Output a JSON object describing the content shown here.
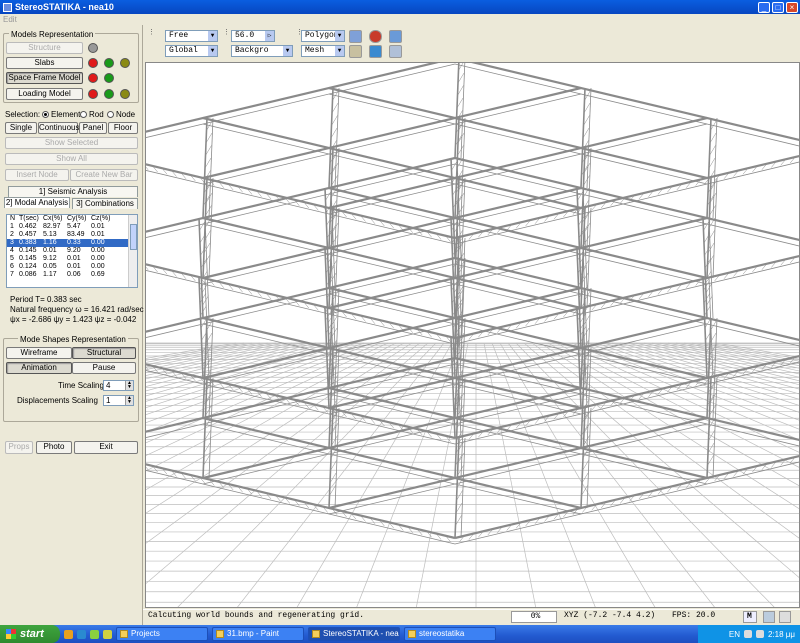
{
  "window": {
    "title": "StereoSTATIKA - nea10",
    "minimize": "_",
    "maximize": "□",
    "close": "×"
  },
  "menu": {
    "edit": "Edit"
  },
  "models": {
    "group_label": "Models Representation",
    "structure": "Structure",
    "slabs": "Slabs",
    "space_frame": "Space Frame Model",
    "loading": "Loading Model"
  },
  "selection": {
    "label": "Selection:",
    "element": "Element",
    "rod": "Rod",
    "node": "Node",
    "single": "Single",
    "continuous": "Continuous",
    "panel": "Panel",
    "floor": "Floor",
    "show_selected": "Show Selected",
    "show_all": "Show All",
    "insert_node": "Insert Node",
    "create_new_bar": "Create New Bar"
  },
  "analysis_tabs": {
    "seismic": "1] Seismic Analysis",
    "modal": "2] Modal Analysis",
    "combinations": "3] Combinations"
  },
  "modal_table": {
    "headers": [
      "N",
      "T(sec)",
      "Cx(%)",
      "Cy(%)",
      "Cz(%)"
    ],
    "rows": [
      [
        "1",
        "0.462",
        "82.97",
        "5.47",
        "0.01"
      ],
      [
        "2",
        "0.457",
        "5.13",
        "83.49",
        "0.01"
      ],
      [
        "3",
        "0.383",
        "1.16",
        "0.33",
        "0.00"
      ],
      [
        "4",
        "0.145",
        "0.01",
        "9.20",
        "0.00"
      ],
      [
        "5",
        "0.145",
        "9.12",
        "0.01",
        "0.00"
      ],
      [
        "6",
        "0.124",
        "0.05",
        "0.01",
        "0.00"
      ],
      [
        "7",
        "0.086",
        "1.17",
        "0.06",
        "0.69"
      ]
    ],
    "selected_row": 2
  },
  "modal_info": {
    "period": "Period T=  0.383    sec",
    "frequency": "Natural frequency ω =  16.421   rad/sec",
    "psi": "ψx = -2.686   ψy = 1.423   ψz = -0.042"
  },
  "mode_shapes": {
    "group_label": "Mode Shapes Representation",
    "wireframe": "Wireframe",
    "structural": "Structural",
    "animation": "Animation",
    "pause": "Pause",
    "time_scaling_label": "Time Scaling",
    "time_scaling_value": "4",
    "disp_scaling_label": "Displacements Scaling",
    "disp_scaling_value": "1"
  },
  "bottom_buttons": {
    "props": "Props",
    "photo": "Photo",
    "exit": "Exit"
  },
  "toolbar": {
    "view_mode": "Free",
    "coord_system": "Global",
    "angle": "56.0",
    "background": "Backgro",
    "polygon": "Polygon",
    "mesh": "Mesh"
  },
  "status": {
    "message": "Calcuting world bounds and regenerating grid.",
    "progress": "0%",
    "xyz": "XYZ (-7.2 -7.4 4.2)",
    "fps": "FPS: 20.0",
    "m_button": "M"
  },
  "taskbar": {
    "start": "start",
    "tasks": [
      "Projects",
      "31.bmp - Paint",
      "StereoSTATIKA - nea10",
      "stereostatika"
    ],
    "active_task": 2,
    "lang": "EN",
    "time": "2:18 μμ"
  },
  "colors": {
    "title_blue": "#0a5ee0",
    "red": "#e01a1a",
    "green": "#1a9a1a",
    "olive": "#8a8a14",
    "selection_blue": "#316ac5"
  }
}
